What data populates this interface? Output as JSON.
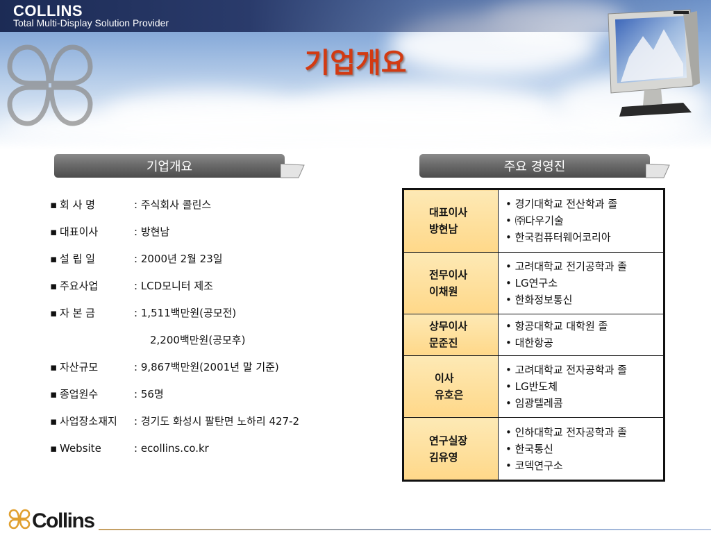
{
  "header": {
    "brand": "COLLINS",
    "tagline": "Total Multi-Display Solution Provider",
    "title": "기업개요"
  },
  "sections": {
    "overview_label": "기업개요",
    "executives_label": "주요 경영진"
  },
  "overview": {
    "bullet": "▪",
    "items": [
      {
        "label": "회 사 명",
        "value": ": 주식회사 콜린스"
      },
      {
        "label": "대표이사",
        "value": ": 방현남"
      },
      {
        "label": "설 립 일",
        "value": ": 2000년 2월 23일"
      },
      {
        "label": "주요사업",
        "value": ": LCD모니터 제조"
      },
      {
        "label": "자 본 금",
        "value": ": 1,511백만원(공모전)"
      },
      {
        "label": "",
        "value": "2,200백만원(공모후)"
      },
      {
        "label": "자산규모",
        "value": ": 9,867백만원(2001년 말 기준)"
      },
      {
        "label": "종업원수",
        "value": ": 56명"
      },
      {
        "label": "사업장소재지",
        "value": ": 경기도 화성시 팔탄면 노하리 427-2"
      },
      {
        "label": "Website",
        "value": ": ecollins.co.kr"
      }
    ]
  },
  "executives": [
    {
      "title": "대표이사",
      "name": "방현남",
      "history": [
        "• 경기대학교 전산학과 졸",
        "• ㈜다우기술",
        "• 한국컴퓨터웨어코리아"
      ]
    },
    {
      "title": "전무이사",
      "name": "이채원",
      "history": [
        "• 고려대학교 전기공학과 졸",
        "• LG연구소",
        "• 한화정보통신"
      ]
    },
    {
      "title": "상무이사",
      "name": "문준진",
      "history": [
        "• 항공대학교 대학원 졸",
        "• 대한항공"
      ]
    },
    {
      "title": "이사",
      "name": "유호은",
      "history": [
        "• 고려대학교 전자공학과 졸",
        "• LG반도체",
        "• 임광텔레콤"
      ]
    },
    {
      "title": "연구실장",
      "name": "김유영",
      "history": [
        "• 인하대학교 전자공학과 졸",
        "• 한국통신",
        "• 코덱연구소"
      ]
    }
  ],
  "footer": {
    "logo_text": "Collins"
  },
  "colors": {
    "title_red": "#d23a12",
    "header_navy": "#1c2b55",
    "tab_gray": "#6b6b6b",
    "name_cell_yellow": "#ffd889"
  }
}
